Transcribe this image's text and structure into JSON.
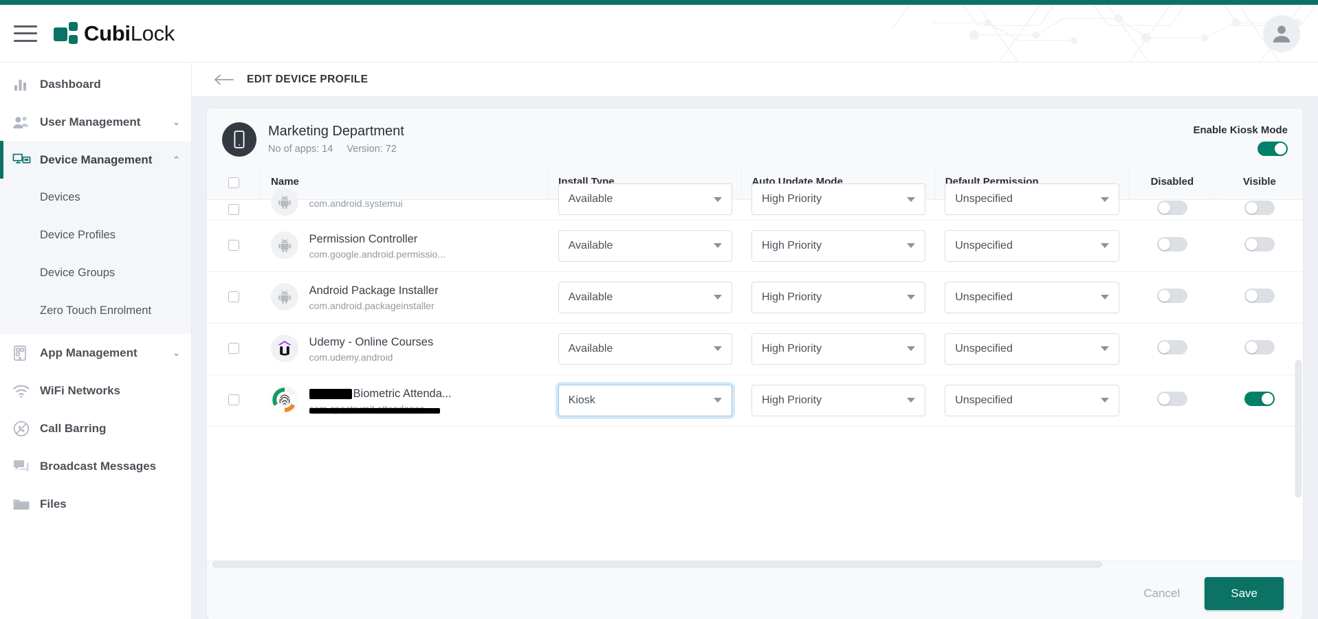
{
  "brand": {
    "name_bold": "Cubi",
    "name_light": "Lock",
    "accent": "#0b7265",
    "toggle_on": "#028068"
  },
  "header": {
    "menu_icon": "hamburger-icon",
    "avatar_icon": "user-avatar-icon"
  },
  "sidebar": {
    "items": [
      {
        "label": "Dashboard",
        "icon": "bar-chart-icon",
        "chevron": "",
        "active": false
      },
      {
        "label": "User Management",
        "icon": "users-icon",
        "chevron": "⌄",
        "active": false
      },
      {
        "label": "Device Management",
        "icon": "devices-icon",
        "chevron": "⌃",
        "active": true
      },
      {
        "label": "App Management",
        "icon": "app-grid-icon",
        "chevron": "⌄",
        "active": false
      },
      {
        "label": "WiFi Networks",
        "icon": "wifi-icon",
        "chevron": "",
        "active": false
      },
      {
        "label": "Call Barring",
        "icon": "call-barred-icon",
        "chevron": "",
        "active": false
      },
      {
        "label": "Broadcast Messages",
        "icon": "chat-bubbles-icon",
        "chevron": "",
        "active": false
      },
      {
        "label": "Files",
        "icon": "folder-icon",
        "chevron": "",
        "active": false
      }
    ],
    "device_management_sub": [
      {
        "label": "Devices"
      },
      {
        "label": "Device Profiles"
      },
      {
        "label": "Device Groups"
      },
      {
        "label": "Zero Touch Enrolment"
      }
    ]
  },
  "breadcrumb": {
    "back_icon": "arrow-left-icon",
    "title": "EDIT DEVICE PROFILE"
  },
  "profile": {
    "avatar_icon": "mobile-phone-icon",
    "name": "Marketing Department",
    "apps_label": "No of apps: 14",
    "version_label": "Version: 72",
    "kiosk_label": "Enable Kiosk Mode",
    "kiosk_enabled": true
  },
  "table": {
    "headers": [
      "",
      "Name",
      "Install Type",
      "Auto Update Mode",
      "Default Permission",
      "Disabled",
      "Visible"
    ],
    "select_all_checked": false,
    "rows": [
      {
        "clipped": true,
        "checked": false,
        "icon": "android-robot-icon",
        "name": "",
        "package": "com.android.systemui",
        "install_type": "Available",
        "auto_update": "High Priority",
        "permission": "Unspecified",
        "disabled": false,
        "visible": false,
        "install_focused": false,
        "redacted_name": false,
        "redacted_pkg": false
      },
      {
        "clipped": false,
        "checked": false,
        "icon": "android-robot-icon",
        "name": "Permission Controller",
        "package": "com.google.android.permissio...",
        "install_type": "Available",
        "auto_update": "High Priority",
        "permission": "Unspecified",
        "disabled": false,
        "visible": false,
        "install_focused": false,
        "redacted_name": false,
        "redacted_pkg": false
      },
      {
        "clipped": false,
        "checked": false,
        "icon": "android-robot-icon",
        "name": "Android Package Installer",
        "package": "com.android.packageinstaller",
        "install_type": "Available",
        "auto_update": "High Priority",
        "permission": "Unspecified",
        "disabled": false,
        "visible": false,
        "install_focused": false,
        "redacted_name": false,
        "redacted_pkg": false
      },
      {
        "clipped": false,
        "checked": false,
        "icon": "udemy-icon",
        "name": "Udemy - Online Courses",
        "package": "com.udemy.android",
        "install_type": "Available",
        "auto_update": "High Priority",
        "permission": "Unspecified",
        "disabled": false,
        "visible": false,
        "install_focused": false,
        "redacted_name": false,
        "redacted_pkg": false
      },
      {
        "clipped": false,
        "checked": false,
        "icon": "fingerprint-icon",
        "name": "Biometric Attenda...",
        "package": "com.spectrumit.attendance",
        "install_type": "Kiosk",
        "auto_update": "High Priority",
        "permission": "Unspecified",
        "disabled": false,
        "visible": true,
        "install_focused": true,
        "redacted_name": true,
        "redacted_pkg": true
      }
    ]
  },
  "footer": {
    "cancel_label": "Cancel",
    "save_label": "Save"
  }
}
